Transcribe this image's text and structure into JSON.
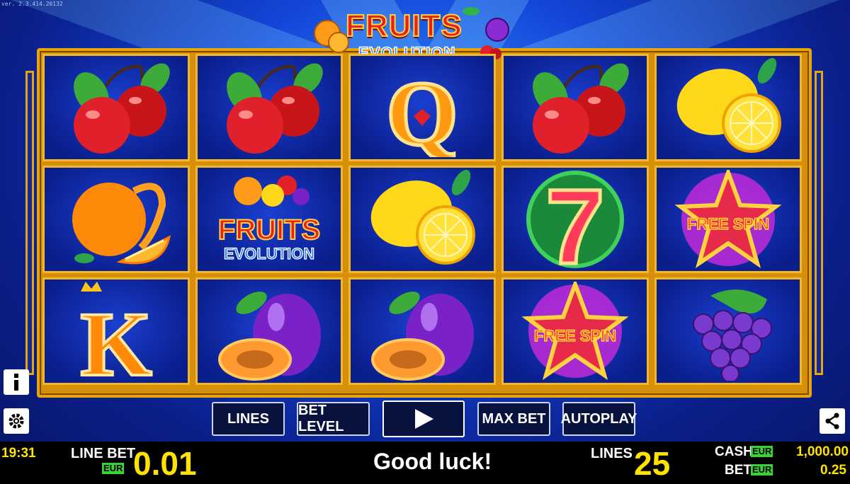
{
  "version": "ver. 2.3.414.20132",
  "logo": {
    "title": "FRUITS",
    "subtitle": "EVOLUTION"
  },
  "reels": [
    [
      "cherry",
      "orange",
      "king"
    ],
    [
      "cherry",
      "fruits-logo",
      "plum"
    ],
    [
      "queen",
      "lemon",
      "plum"
    ],
    [
      "cherry",
      "seven",
      "free-spin"
    ],
    [
      "lemon",
      "free-spin",
      "grape"
    ]
  ],
  "symbol_text": {
    "free_spin": "FREE SPIN",
    "queen": "Q",
    "king": "K",
    "seven": "7",
    "logo_title": "FRUITS",
    "logo_sub": "EVOLUTION"
  },
  "buttons": {
    "lines": "LINES",
    "bet_level": "BET LEVEL",
    "max_bet": "MAX BET",
    "autoplay": "AUTOPLAY"
  },
  "status": {
    "time": "19:31",
    "line_bet_label": "LINE BET",
    "currency": "EUR",
    "line_bet_value": "0.01",
    "message": "Good luck!",
    "lines_label": "LINES",
    "lines_value": "25",
    "cash_label": "CASH",
    "cash_value": "1,000.00",
    "bet_label": "BET",
    "bet_value": "0.25"
  },
  "colors": {
    "frame": "#e8a40c",
    "accent": "#ffe200",
    "currency_badge": "#3bd13b"
  }
}
